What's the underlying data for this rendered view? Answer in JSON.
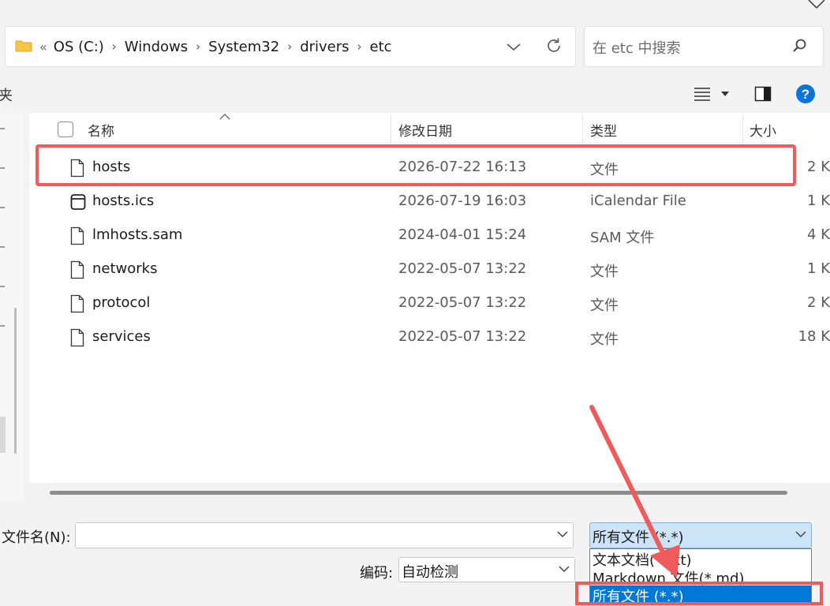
{
  "address": {
    "lead": "«",
    "crumbs": [
      "OS (C:)",
      "Windows",
      "System32",
      "drivers",
      "etc"
    ]
  },
  "search": {
    "placeholder": "在 etc 中搜索"
  },
  "toolbar": {
    "left_fragment": "夹"
  },
  "columns": {
    "name": "名称",
    "date": "修改日期",
    "type": "类型",
    "size": "大小"
  },
  "files": [
    {
      "name": "hosts",
      "date": "2026-07-22 16:13",
      "type": "文件",
      "size": "2 K",
      "icon": "file-icon"
    },
    {
      "name": "hosts.ics",
      "date": "2026-07-19 16:03",
      "type": "iCalendar File",
      "size": "1 K",
      "icon": "calendar-file-icon"
    },
    {
      "name": "lmhosts.sam",
      "date": "2024-04-01 15:24",
      "type": "SAM 文件",
      "size": "4 K",
      "icon": "file-icon"
    },
    {
      "name": "networks",
      "date": "2022-05-07 13:22",
      "type": "文件",
      "size": "1 K",
      "icon": "file-icon"
    },
    {
      "name": "protocol",
      "date": "2022-05-07 13:22",
      "type": "文件",
      "size": "2 K",
      "icon": "file-icon"
    },
    {
      "name": "services",
      "date": "2022-05-07 13:22",
      "type": "文件",
      "size": "18 K",
      "icon": "file-icon"
    }
  ],
  "bottom": {
    "filename_label": "文件名(N):",
    "filename_value": "",
    "filetype_selected": "所有文件 (*.*)",
    "encoding_label": "编码:",
    "encoding_value": "自动检测"
  },
  "filetype_options": [
    "文本文档(*.txt)",
    "Markdown 文件(*.md)",
    "所有文件 (*.*)"
  ],
  "colors": {
    "highlight": "#ef5a5a",
    "selection": "#0078d7",
    "help": "#0a74da"
  }
}
